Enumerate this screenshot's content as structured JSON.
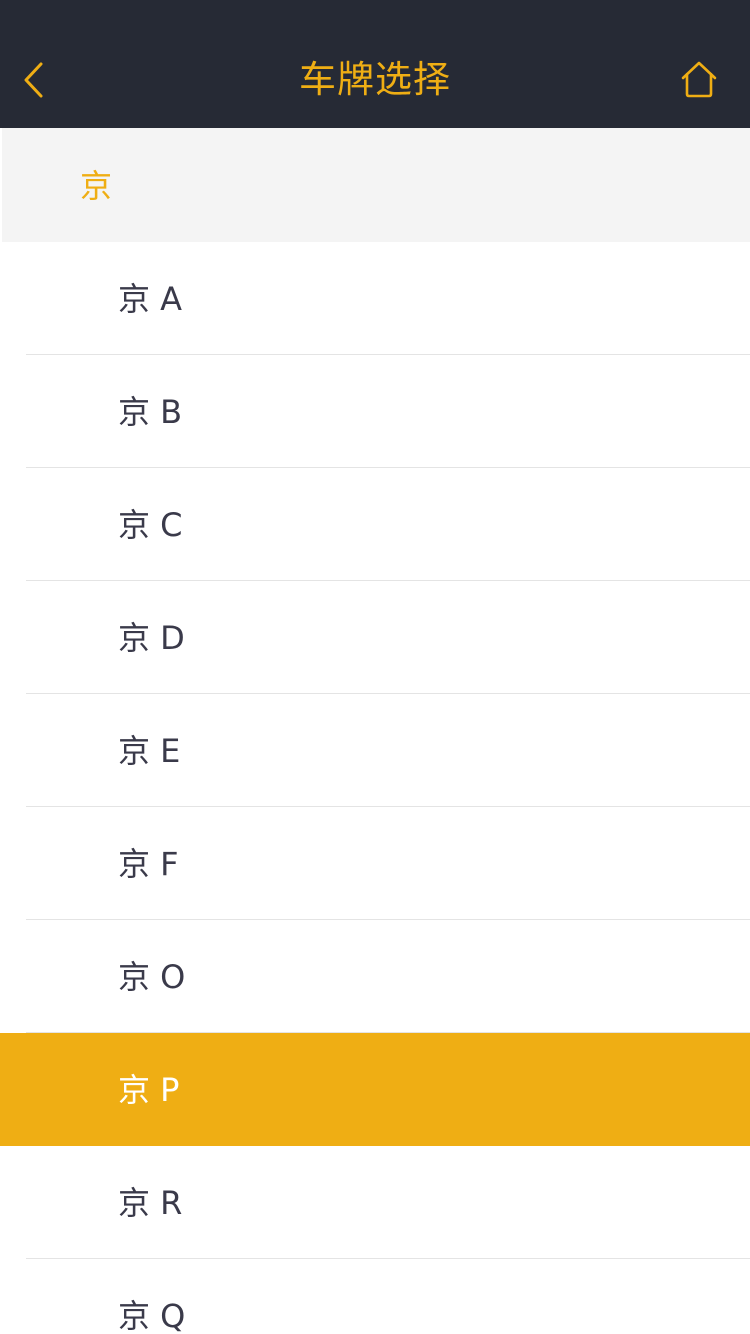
{
  "theme": {
    "accent": "#efae14",
    "navbar_bg": "#262a35",
    "header_bg": "#f4f4f4",
    "text": "#3a3a4a",
    "selected_text": "#ffffff"
  },
  "navbar": {
    "title": "车牌选择",
    "back_icon": "chevron-left-icon",
    "home_icon": "home-icon"
  },
  "group": {
    "label": "京"
  },
  "list": {
    "items": [
      {
        "label": "京 A",
        "selected": false
      },
      {
        "label": "京 B",
        "selected": false
      },
      {
        "label": "京 C",
        "selected": false
      },
      {
        "label": "京 D",
        "selected": false
      },
      {
        "label": "京 E",
        "selected": false
      },
      {
        "label": "京 F",
        "selected": false
      },
      {
        "label": "京 O",
        "selected": false
      },
      {
        "label": "京 P",
        "selected": true
      },
      {
        "label": "京 R",
        "selected": false
      },
      {
        "label": "京 Q",
        "selected": false
      }
    ]
  }
}
